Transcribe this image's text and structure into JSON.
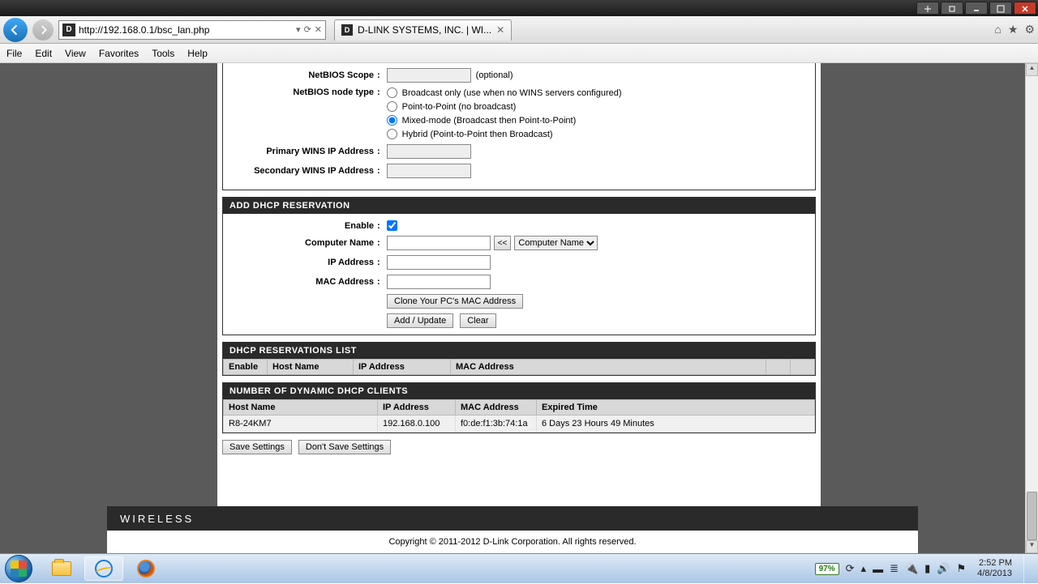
{
  "window": {
    "address_url": "http://192.168.0.1/bsc_lan.php",
    "tab_title": "D-LINK SYSTEMS, INC. | WI..."
  },
  "menubar": [
    "File",
    "Edit",
    "View",
    "Favorites",
    "Tools",
    "Help"
  ],
  "netbios": {
    "scope_label": "NetBIOS Scope",
    "scope_value": "",
    "scope_hint": "(optional)",
    "node_type_label": "NetBIOS node type",
    "node_types": [
      "Broadcast only (use when no WINS servers configured)",
      "Point-to-Point (no broadcast)",
      "Mixed-mode (Broadcast then Point-to-Point)",
      "Hybrid (Point-to-Point then Broadcast)"
    ],
    "node_selected": 2,
    "primary_wins_label": "Primary WINS IP Address",
    "primary_wins_value": "",
    "secondary_wins_label": "Secondary WINS IP Address",
    "secondary_wins_value": ""
  },
  "reservation": {
    "header": "ADD DHCP RESERVATION",
    "enable_label": "Enable",
    "enable_checked": true,
    "computer_name_label": "Computer Name",
    "computer_name_value": "",
    "computer_select_default": "Computer Name",
    "ip_label": "IP Address",
    "ip_value": "",
    "mac_label": "MAC Address",
    "mac_value": "",
    "clone_btn": "Clone Your PC's MAC Address",
    "add_btn": "Add / Update",
    "clear_btn": "Clear",
    "arrow_btn": "<<"
  },
  "reservations_list": {
    "header": "DHCP RESERVATIONS LIST",
    "cols": [
      "Enable",
      "Host Name",
      "IP Address",
      "MAC Address",
      "",
      ""
    ]
  },
  "clients": {
    "header": "NUMBER OF DYNAMIC DHCP CLIENTS",
    "cols": [
      "Host Name",
      "IP Address",
      "MAC Address",
      "Expired Time"
    ],
    "rows": [
      {
        "host": "R8-24KM7",
        "ip": "192.168.0.100",
        "mac": "f0:de:f1:3b:74:1a",
        "expired": "6 Days 23 Hours 49 Minutes"
      }
    ]
  },
  "save": {
    "save_btn": "Save Settings",
    "dont_save_btn": "Don't Save Settings"
  },
  "footer": {
    "brand": "WIRELESS",
    "copyright": "Copyright © 2011-2012 D-Link Corporation. All rights reserved."
  },
  "tray": {
    "battery": "97%",
    "time": "2:52 PM",
    "date": "4/8/2013"
  }
}
